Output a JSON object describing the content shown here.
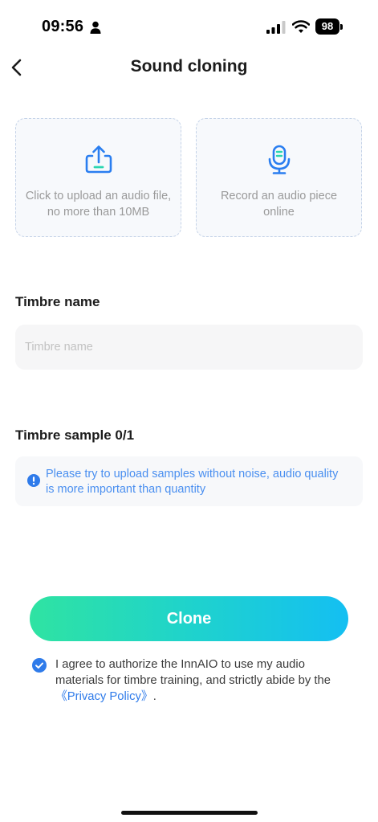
{
  "status_bar": {
    "time": "09:56",
    "battery": "98",
    "icons": [
      "person-icon",
      "signal-icon",
      "wifi-icon",
      "battery-icon"
    ]
  },
  "nav": {
    "title": "Sound cloning",
    "back_icon": "chevron-left-icon"
  },
  "upload_options": [
    {
      "label": "Click to upload an audio file, no more than 10MB",
      "icon": "upload-icon"
    },
    {
      "label": "Record an audio piece online",
      "icon": "microphone-icon"
    }
  ],
  "timbre_name": {
    "label": "Timbre name",
    "placeholder": "Timbre name",
    "value": ""
  },
  "timbre_sample": {
    "label": "Timbre sample 0/1",
    "notice": "Please try to upload samples without noise, audio quality is more important than quantity",
    "notice_icon": "info-icon"
  },
  "clone_button": {
    "label": "Clone"
  },
  "agreement": {
    "checked": true,
    "text": "I agree to authorize the InnAIO to use my audio materials for timbre training, and strictly abide by the ",
    "link": "《Privacy Policy》",
    "suffix": "."
  },
  "colors": {
    "accent_blue": "#2f7bea",
    "gradient_start": "#2fe3a2",
    "gradient_end": "#14bff2",
    "notice_text": "#4a8ff0"
  }
}
